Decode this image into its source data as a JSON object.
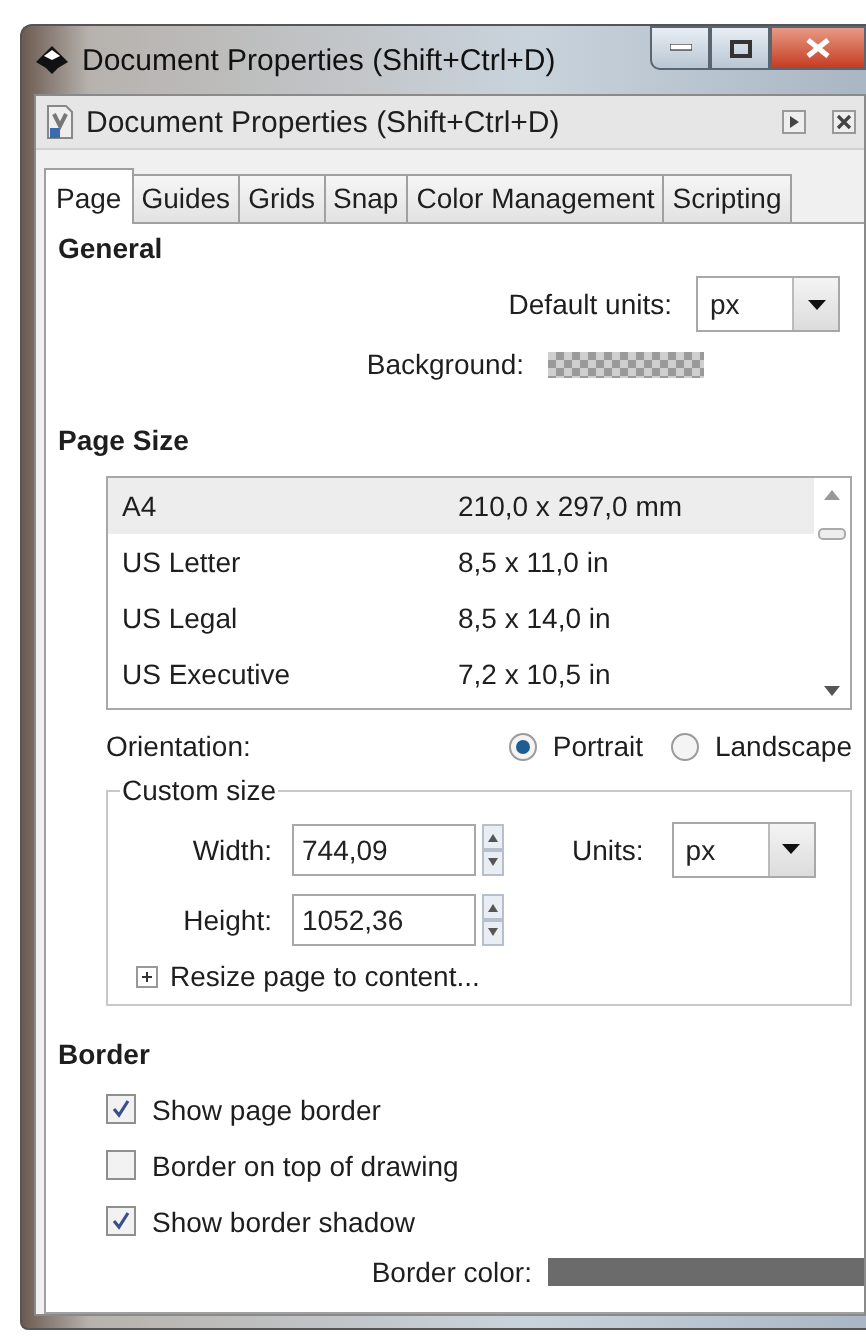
{
  "window": {
    "title": "Document Properties (Shift+Ctrl+D)"
  },
  "panel": {
    "title": "Document Properties (Shift+Ctrl+D)"
  },
  "tabs": [
    {
      "label": "Page",
      "selected": true
    },
    {
      "label": "Guides",
      "selected": false
    },
    {
      "label": "Grids",
      "selected": false
    },
    {
      "label": "Snap",
      "selected": false
    },
    {
      "label": "Color Management",
      "selected": false
    },
    {
      "label": "Scripting",
      "selected": false
    }
  ],
  "general": {
    "heading": "General",
    "default_units": {
      "label": "Default units:",
      "value": "px"
    },
    "background": {
      "label": "Background:"
    }
  },
  "page_size": {
    "heading": "Page Size",
    "rows": [
      {
        "name": "A4",
        "size": "210,0 x 297,0 mm",
        "selected": true
      },
      {
        "name": "US Letter",
        "size": "8,5 x 11,0 in",
        "selected": false
      },
      {
        "name": "US Legal",
        "size": "8,5 x 14,0 in",
        "selected": false
      },
      {
        "name": "US Executive",
        "size": "7,2 x 10,5 in",
        "selected": false
      }
    ]
  },
  "orientation": {
    "label": "Orientation:",
    "options": [
      {
        "label": "Portrait",
        "selected": true
      },
      {
        "label": "Landscape",
        "selected": false
      }
    ]
  },
  "custom_size": {
    "title": "Custom size",
    "width": {
      "label": "Width:",
      "value": "744,09"
    },
    "height": {
      "label": "Height:",
      "value": "1052,36"
    },
    "units": {
      "label": "Units:",
      "value": "px"
    },
    "resize": {
      "label": "Resize page to content...",
      "expanded": false
    }
  },
  "border": {
    "heading": "Border",
    "options": [
      {
        "label": "Show page border",
        "checked": true
      },
      {
        "label": "Border on top of drawing",
        "checked": false
      },
      {
        "label": "Show border shadow",
        "checked": true
      }
    ],
    "color": {
      "label": "Border color:"
    }
  }
}
